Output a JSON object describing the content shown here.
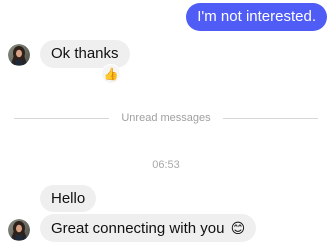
{
  "messages": {
    "outgoing_1": "I'm not interested.",
    "incoming_1": "Ok thanks",
    "incoming_2": "Hello",
    "incoming_3": "Great connecting with you"
  },
  "reactions": {
    "incoming_1": "👍"
  },
  "emojis": {
    "incoming_3": "😊"
  },
  "divider": {
    "label": "Unread messages"
  },
  "timestamp": "06:53",
  "colors": {
    "outgoing_bubble": "#4f5cf6",
    "incoming_bubble": "#efefef",
    "muted_text": "#a0a0a0"
  }
}
